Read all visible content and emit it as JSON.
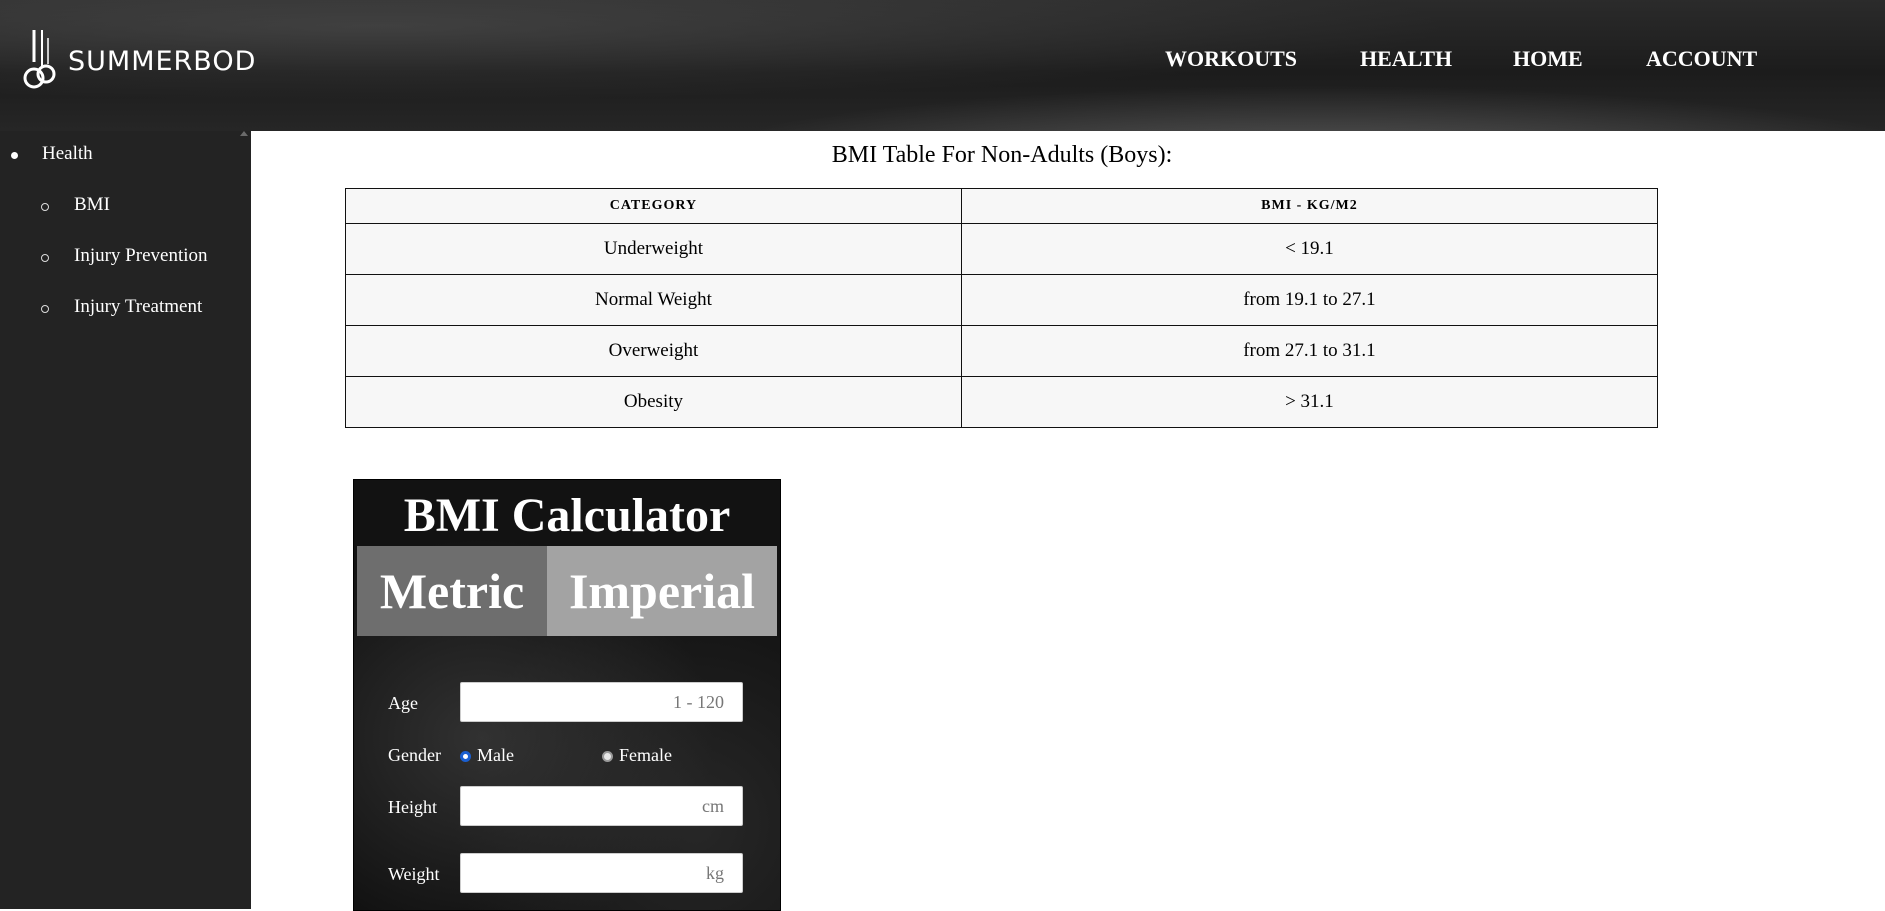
{
  "brand": {
    "name": "SUMMERBOD"
  },
  "nav": {
    "items": [
      {
        "label": "WORKOUTS"
      },
      {
        "label": "HEALTH"
      },
      {
        "label": "HOME"
      },
      {
        "label": "ACCOUNT"
      }
    ]
  },
  "sidebar": {
    "section": {
      "label": "Health"
    },
    "items": [
      {
        "label": "BMI"
      },
      {
        "label": "Injury Prevention"
      },
      {
        "label": "Injury Treatment"
      }
    ]
  },
  "bmi_table": {
    "caption": "BMI Table For Non-Adults (Boys):",
    "headers": [
      "CATEGORY",
      "BMI - KG/M2"
    ],
    "rows": [
      [
        "Underweight",
        "< 19.1"
      ],
      [
        "Normal Weight",
        "from 19.1 to 27.1"
      ],
      [
        "Overweight",
        "from 27.1 to 31.1"
      ],
      [
        "Obesity",
        "> 31.1"
      ]
    ]
  },
  "calculator": {
    "title": "BMI Calculator",
    "tabs": {
      "metric": "Metric",
      "imperial": "Imperial"
    },
    "age": {
      "label": "Age",
      "placeholder": "1 - 120"
    },
    "gender": {
      "label": "Gender",
      "male": "Male",
      "female": "Female",
      "selected": "Male"
    },
    "height": {
      "label": "Height",
      "placeholder": "cm"
    },
    "weight": {
      "label": "Weight",
      "placeholder": "kg"
    }
  }
}
